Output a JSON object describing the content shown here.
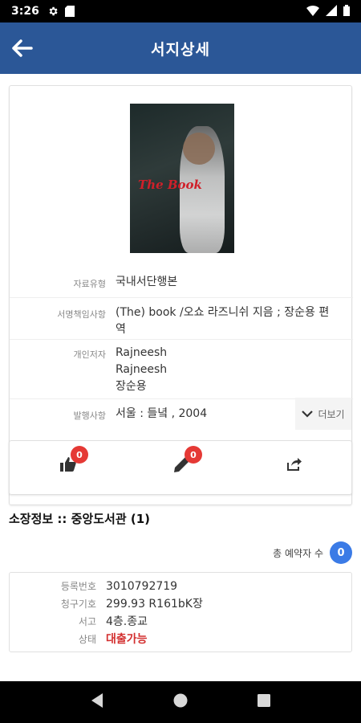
{
  "status_bar": {
    "time": "3:26"
  },
  "app_bar": {
    "title": "서지상세"
  },
  "book": {
    "cover_title": "The Book",
    "fields": [
      {
        "label": "자료유형",
        "value": "국내서단행본"
      },
      {
        "label": "서명책임사항",
        "value": "(The) book  /오쇼 라즈니쉬 지음 ; 장순용 편역"
      },
      {
        "label": "개인저자",
        "lines": [
          "Rajneesh",
          "Rajneesh",
          "장순용"
        ]
      },
      {
        "label": "발행사항",
        "value": "서울 : 들녘 , 2004"
      }
    ],
    "more_label": "더보기"
  },
  "actions": {
    "like_count": "0",
    "review_count": "0"
  },
  "holdings": {
    "title": "소장정보 :: 중앙도서관 (1)",
    "reserve_label": "총 예약자 수",
    "reserve_count": "0",
    "items": [
      {
        "label": "등록번호",
        "value": "3010792719"
      },
      {
        "label": "청구기호",
        "value": "299.93 R161bK장"
      },
      {
        "label": "서고",
        "value": "4층.종교"
      },
      {
        "label": "상태",
        "value": "대출가능"
      }
    ]
  },
  "colors": {
    "app_bar": "#2b5797",
    "badge": "#e53935",
    "status_available": "#d32f2f",
    "reserve_count": "#3b7be6"
  }
}
